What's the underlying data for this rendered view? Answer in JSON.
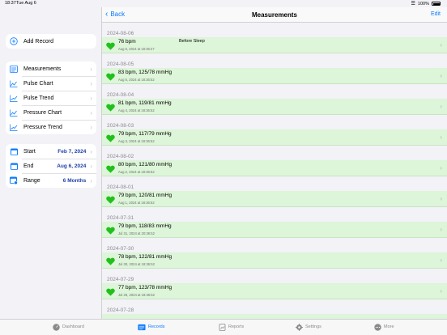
{
  "status": {
    "time": "18:37",
    "date": "Tue Aug 6",
    "battery": "100%"
  },
  "sidebar": {
    "add": {
      "label": "Add Record",
      "icon": "plus-circle-icon"
    },
    "nav": [
      {
        "label": "Measurements",
        "icon": "list-icon"
      },
      {
        "label": "Pulse Chart",
        "icon": "chart-icon"
      },
      {
        "label": "Pulse Trend",
        "icon": "trend-icon"
      },
      {
        "label": "Pressure Chart",
        "icon": "chart-icon"
      },
      {
        "label": "Pressure Trend",
        "icon": "trend-icon"
      }
    ],
    "filters": [
      {
        "label": "Start",
        "value": "Feb 7, 2024",
        "icon": "calendar-icon"
      },
      {
        "label": "End",
        "value": "Aug 6, 2024",
        "icon": "calendar-icon"
      },
      {
        "label": "Range",
        "value": "6 Months",
        "icon": "calendar-range-icon"
      }
    ]
  },
  "navbar": {
    "back": "Back",
    "title": "Measurements",
    "edit": "Edit"
  },
  "measurements": [
    {
      "date": "2024-08-06",
      "primary": "76 bpm",
      "note": "Before Sleep",
      "secondary": "Aug 6, 2024 at 18:36:27"
    },
    {
      "date": "2024-08-05",
      "primary": "83 bpm, 125/78 mmHg",
      "note": "",
      "secondary": "Aug 5, 2024 at 18:36:52"
    },
    {
      "date": "2024-08-04",
      "primary": "81 bpm, 119/81 mmHg",
      "note": "",
      "secondary": "Aug 4, 2024 at 18:36:52"
    },
    {
      "date": "2024-08-03",
      "primary": "79 bpm, 117/79 mmHg",
      "note": "",
      "secondary": "Aug 3, 2024 at 18:36:52"
    },
    {
      "date": "2024-08-02",
      "primary": "80 bpm, 121/80 mmHg",
      "note": "",
      "secondary": "Aug 2, 2024 at 18:36:52"
    },
    {
      "date": "2024-08-01",
      "primary": "79 bpm, 120/81 mmHg",
      "note": "",
      "secondary": "Aug 1, 2024 at 18:36:52"
    },
    {
      "date": "2024-07-31",
      "primary": "79 bpm, 118/83 mmHg",
      "note": "",
      "secondary": "Jul 31, 2024 at 20:36:52"
    },
    {
      "date": "2024-07-30",
      "primary": "78 bpm, 122/81 mmHg",
      "note": "",
      "secondary": "Jul 30, 2024 at 18:36:52"
    },
    {
      "date": "2024-07-29",
      "primary": "77 bpm, 123/78 mmHg",
      "note": "",
      "secondary": "Jul 29, 2024 at 18:36:52"
    },
    {
      "date": "2024-07-28",
      "primary": "",
      "note": "",
      "secondary": ""
    }
  ],
  "tabs": [
    {
      "label": "Dashboard",
      "icon": "dashboard-icon",
      "active": false
    },
    {
      "label": "Records",
      "icon": "records-icon",
      "active": true
    },
    {
      "label": "Reports",
      "icon": "reports-icon",
      "active": false
    },
    {
      "label": "Settings",
      "icon": "gear-icon",
      "active": false
    },
    {
      "label": "More",
      "icon": "more-icon",
      "active": false
    }
  ],
  "colors": {
    "accent": "#0a7aff",
    "row_bg": "#ddf5d8",
    "heart": "#22c01d",
    "value": "#1c3fa8"
  }
}
